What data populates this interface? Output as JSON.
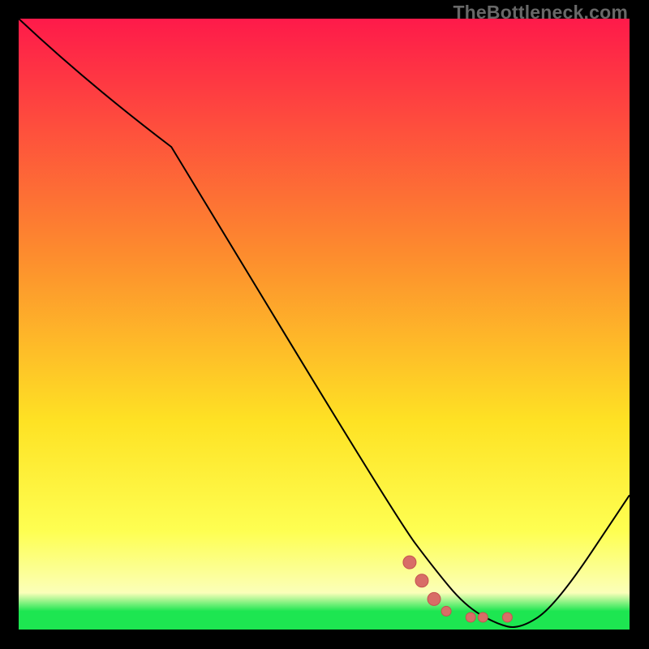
{
  "watermark": "TheBottleneck.com",
  "colors": {
    "top": "#fe1a4a",
    "mid1": "#fd8a2e",
    "mid2": "#fee224",
    "mid3": "#feff52",
    "low": "#fbffb9",
    "green": "#1de651",
    "curve": "#000000",
    "marker_fill": "#d86d67",
    "marker_stroke": "#c5524e"
  },
  "chart_data": {
    "type": "line",
    "title": "",
    "xlabel": "",
    "ylabel": "",
    "xlim": [
      0,
      100
    ],
    "ylim": [
      0,
      100
    ],
    "series": [
      {
        "name": "bottleneck-curve",
        "x": [
          0,
          25,
          62,
          68,
          73,
          78,
          82,
          88,
          100
        ],
        "y": [
          100,
          79,
          18,
          10,
          4,
          1,
          0,
          4,
          22
        ]
      }
    ],
    "markers": [
      {
        "name": "dot-series",
        "x": [
          64,
          66,
          68,
          70,
          74,
          76,
          80
        ],
        "y": [
          11,
          8,
          5,
          3,
          2,
          2,
          2
        ]
      }
    ],
    "gradient_stops": [
      {
        "pct": 0,
        "key": "top"
      },
      {
        "pct": 38,
        "key": "mid1"
      },
      {
        "pct": 66,
        "key": "mid2"
      },
      {
        "pct": 84,
        "key": "mid3"
      },
      {
        "pct": 94,
        "key": "low"
      },
      {
        "pct": 97,
        "key": "green"
      },
      {
        "pct": 100,
        "key": "green"
      }
    ]
  }
}
